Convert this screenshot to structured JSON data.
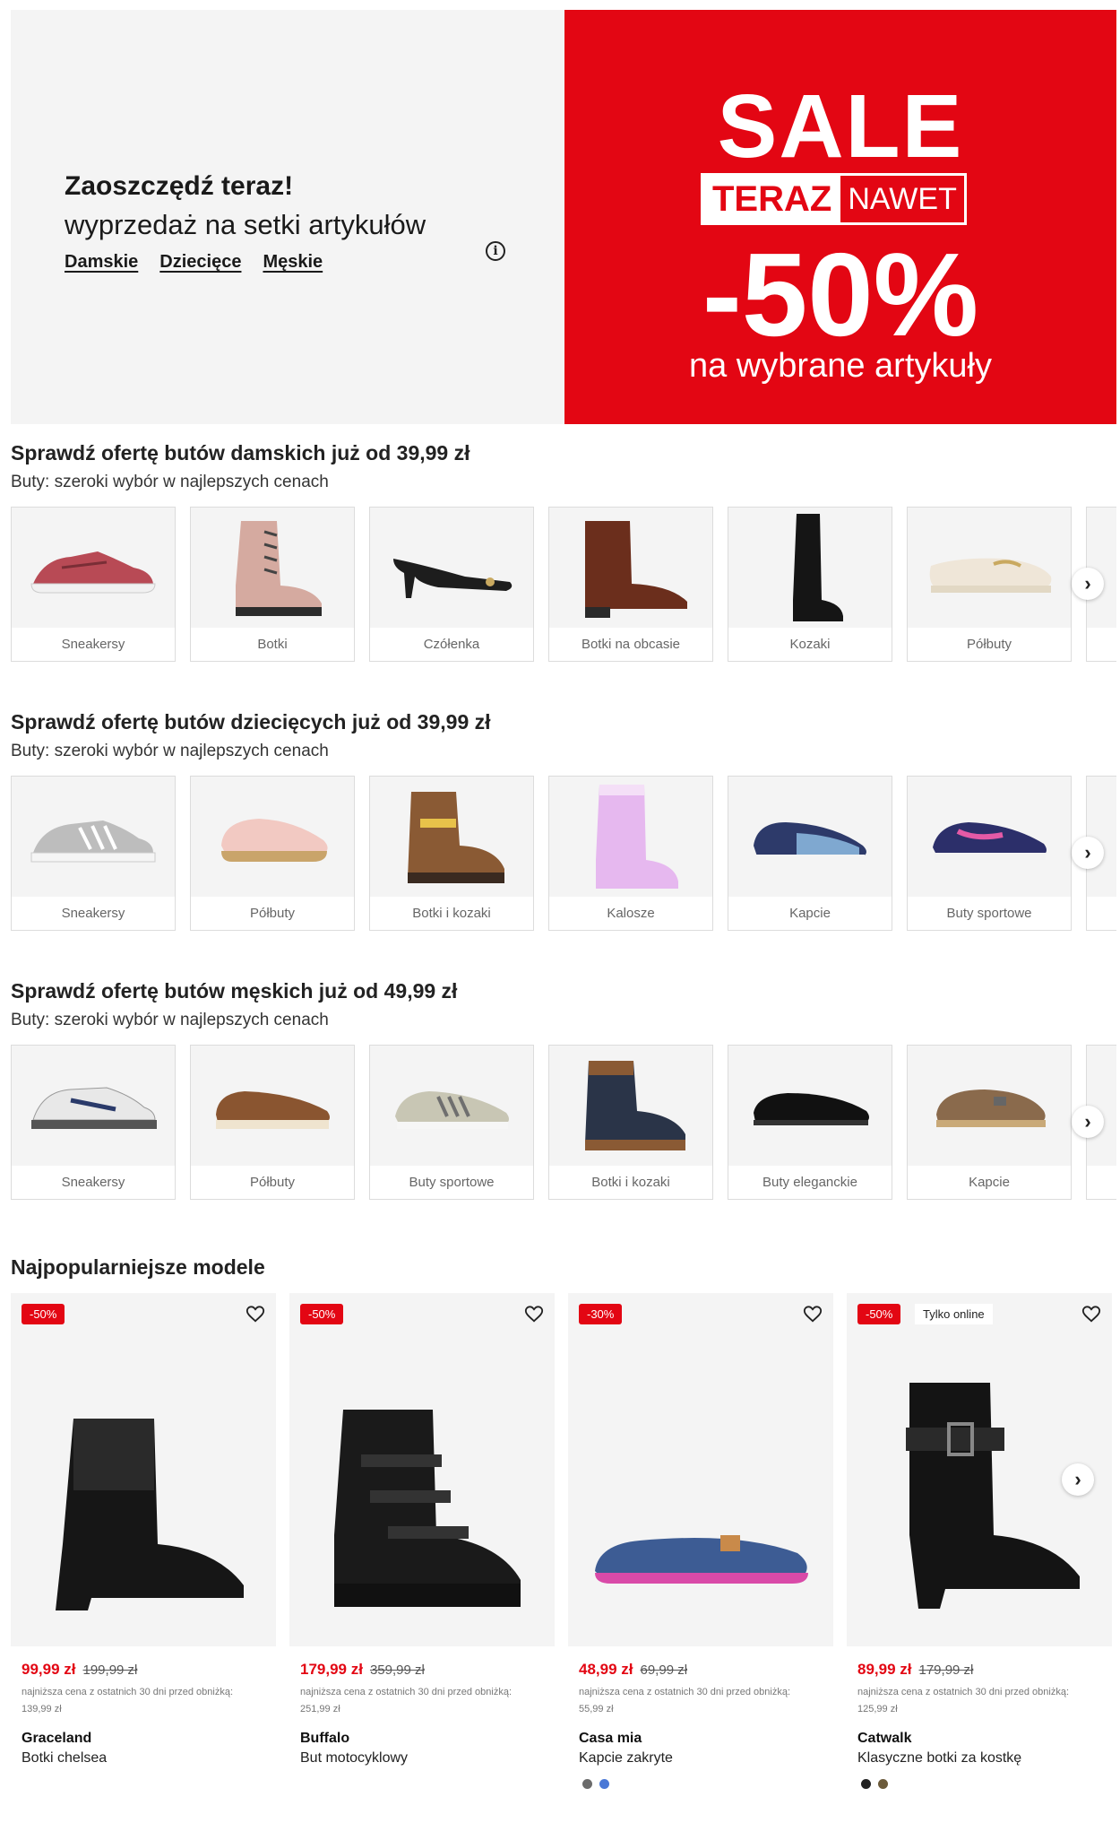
{
  "hero": {
    "title": "Zaoszczędź teraz!",
    "subtitle": "wyprzedaż na setki artykułów",
    "links": [
      "Damskie",
      "Dziecięce",
      "Męskie"
    ],
    "info_icon": "info-icon",
    "sale_word": "SALE",
    "teraz": "TERAZ",
    "nawet": "NAWET",
    "discount": "-50%",
    "note": "na wybrane artykuły",
    "colors": {
      "left_bg": "#f4f4f4",
      "right_bg": "#e30613"
    }
  },
  "sections": [
    {
      "title": "Sprawdź ofertę butów damskich już od 39,99 zł",
      "subtitle": "Buty: szeroki wybór w najlepszych cenach",
      "items": [
        "Sneakersy",
        "Botki",
        "Czółenka",
        "Botki na obcasie",
        "Kozaki",
        "Półbuty"
      ]
    },
    {
      "title": "Sprawdź ofertę butów dziecięcych już od 39,99 zł",
      "subtitle": "Buty: szeroki wybór w najlepszych cenach",
      "items": [
        "Sneakersy",
        "Półbuty",
        "Botki i kozaki",
        "Kalosze",
        "Kapcie",
        "Buty sportowe"
      ]
    },
    {
      "title": "Sprawdź ofertę butów męskich już od 49,99 zł",
      "subtitle": "Buty: szeroki wybór w najlepszych cenach",
      "items": [
        "Sneakersy",
        "Półbuty",
        "Buty sportowe",
        "Botki i kozaki",
        "Buty eleganckie",
        "Kapcie"
      ]
    }
  ],
  "popular": {
    "title": "Najpopularniejsze modele",
    "products": [
      {
        "badge": "-50%",
        "online": "",
        "price": "99,99 zł",
        "old_price": "199,99 zł",
        "lowest_label": "najniższa cena z ostatnich 30 dni przed obniżką:",
        "lowest_value": "139,99 zł",
        "brand": "Graceland",
        "model": "Botki chelsea",
        "swatches": []
      },
      {
        "badge": "-50%",
        "online": "",
        "price": "179,99 zł",
        "old_price": "359,99 zł",
        "lowest_label": "najniższa cena z ostatnich 30 dni przed obniżką:",
        "lowest_value": "251,99 zł",
        "brand": "Buffalo",
        "model": "But motocyklowy",
        "swatches": []
      },
      {
        "badge": "-30%",
        "online": "",
        "price": "48,99 zł",
        "old_price": "69,99 zł",
        "lowest_label": "najniższa cena z ostatnich 30 dni przed obniżką:",
        "lowest_value": "55,99 zł",
        "brand": "Casa mia",
        "model": "Kapcie zakryte",
        "swatches": [
          "#6b6b6b",
          "#4a78d6"
        ]
      },
      {
        "badge": "-50%",
        "online": "Tylko online",
        "price": "89,99 zł",
        "old_price": "179,99 zł",
        "lowest_label": "najniższa cena z ostatnich 30 dni przed obniżką:",
        "lowest_value": "125,99 zł",
        "brand": "Catwalk",
        "model": "Klasyczne botki za kostkę",
        "swatches": [
          "#222222",
          "#6b5a3a"
        ]
      }
    ]
  },
  "icons": {
    "next": "chevron-right-icon",
    "favorite": "heart-icon"
  },
  "accent_color": "#e30613"
}
